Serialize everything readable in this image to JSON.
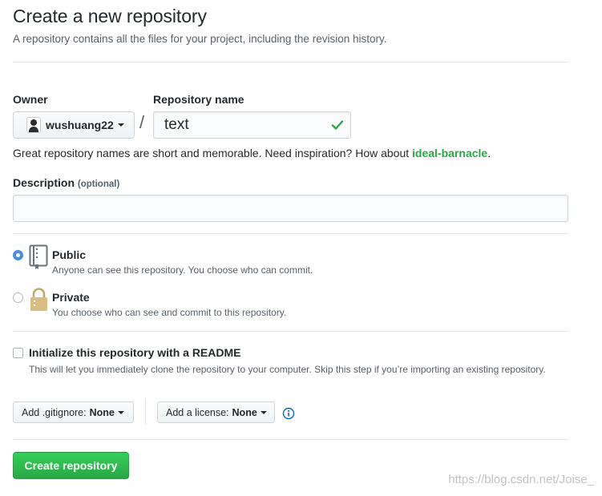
{
  "header": {
    "title": "Create a new repository",
    "subtitle": "A repository contains all the files for your project, including the revision history."
  },
  "owner": {
    "label": "Owner",
    "value": "wushuang22"
  },
  "separator": "/",
  "repo_name": {
    "label": "Repository name",
    "value": "text",
    "valid_icon": "check-icon"
  },
  "hint": {
    "text": "Great repository names are short and memorable. Need inspiration? How about ",
    "suggestion": "ideal-barnacle",
    "end": "."
  },
  "description": {
    "label": "Description",
    "optional": "(optional)",
    "value": ""
  },
  "visibility": {
    "selected": "public",
    "public": {
      "title": "Public",
      "note": "Anyone can see this repository. You choose who can commit.",
      "icon": "repo-book-icon"
    },
    "private": {
      "title": "Private",
      "note": "You choose who can see and commit to this repository.",
      "icon": "lock-icon"
    }
  },
  "init": {
    "checked": false,
    "title": "Initialize this repository with a README",
    "note": "This will let you immediately clone the repository to your computer. Skip this step if you’re importing an existing repository."
  },
  "gitignore": {
    "label": "Add .gitignore:",
    "value": "None"
  },
  "license": {
    "label": "Add a license:",
    "value": "None",
    "info_icon": "info-icon"
  },
  "create_button": "Create repository",
  "watermark": "https://blog.csdn.net/Joise_",
  "colors": {
    "accent_green": "#28a745",
    "radio_blue": "#4a90e2",
    "text": "#24292e",
    "muted": "#586069"
  }
}
